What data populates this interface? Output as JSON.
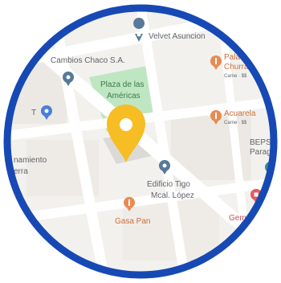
{
  "map": {
    "center_pin_icon": "location-pin-icon",
    "colors": {
      "frame": "#1749b5",
      "land": "#f3f1ee",
      "road": "#ffffff",
      "block": "#e4e2df",
      "park": "#bfe6c2",
      "pin": "#f6bd24",
      "poi_blue": "#57799a",
      "poi_orange": "#e88b53",
      "poi_red": "#e7585e",
      "poi_teal": "#3b8c8a",
      "label_gray": "#5f6368"
    },
    "pois": [
      {
        "name": "Velvet Asuncion",
        "icon": "map-pin-icon",
        "color": "blue"
      },
      {
        "name": "Cambios Chaco S.A.",
        "icon": "map-pin-icon",
        "color": "blue"
      },
      {
        "name": "Plaza de las Américas",
        "icon": "map-pin-icon",
        "color": "green"
      },
      {
        "name": "Paladar Churrasquería",
        "subtitle": "Carne · $$",
        "icon": "restaurant-icon",
        "color": "orange"
      },
      {
        "name": "Acuarela",
        "subtitle": "Carne · $$",
        "icon": "restaurant-icon",
        "color": "orange"
      },
      {
        "name": "BEPSA Paraguay",
        "icon": "map-pin-icon",
        "color": "teal"
      },
      {
        "name": "Edificio Tigo Mcal. López",
        "icon": "map-pin-icon",
        "color": "blue"
      },
      {
        "name": "Gasa Pan",
        "icon": "restaurant-icon",
        "color": "orange"
      },
      {
        "name": "Gema S.",
        "icon": "shopping-icon",
        "color": "red"
      },
      {
        "name": "Alojamiento Terra",
        "icon": "map-pin-icon",
        "color": "blue"
      },
      {
        "name": "T",
        "icon": "map-pin-icon",
        "color": "blue"
      }
    ],
    "labels": {
      "velvet": "Velvet Asuncion",
      "cambios": "Cambios Chaco S.A.",
      "plaza_1": "Plaza de las",
      "plaza_2": "Américas",
      "paladar_1": "Paladar",
      "paladar_2": "Churras",
      "paladar_sub": "Carne · $$",
      "acuarela": "Acuarela",
      "acuarela_sub": "Carne · $$",
      "bepsa_1": "BEPSA",
      "bepsa_2": "Paragua",
      "tigo_1": "Edificio Tigo",
      "tigo_2": "Mcal. López",
      "gasa": "Gasa Pan",
      "gema": "Gema S",
      "aloj_1": "namiento",
      "aloj_2": "erra",
      "t": "T"
    }
  }
}
